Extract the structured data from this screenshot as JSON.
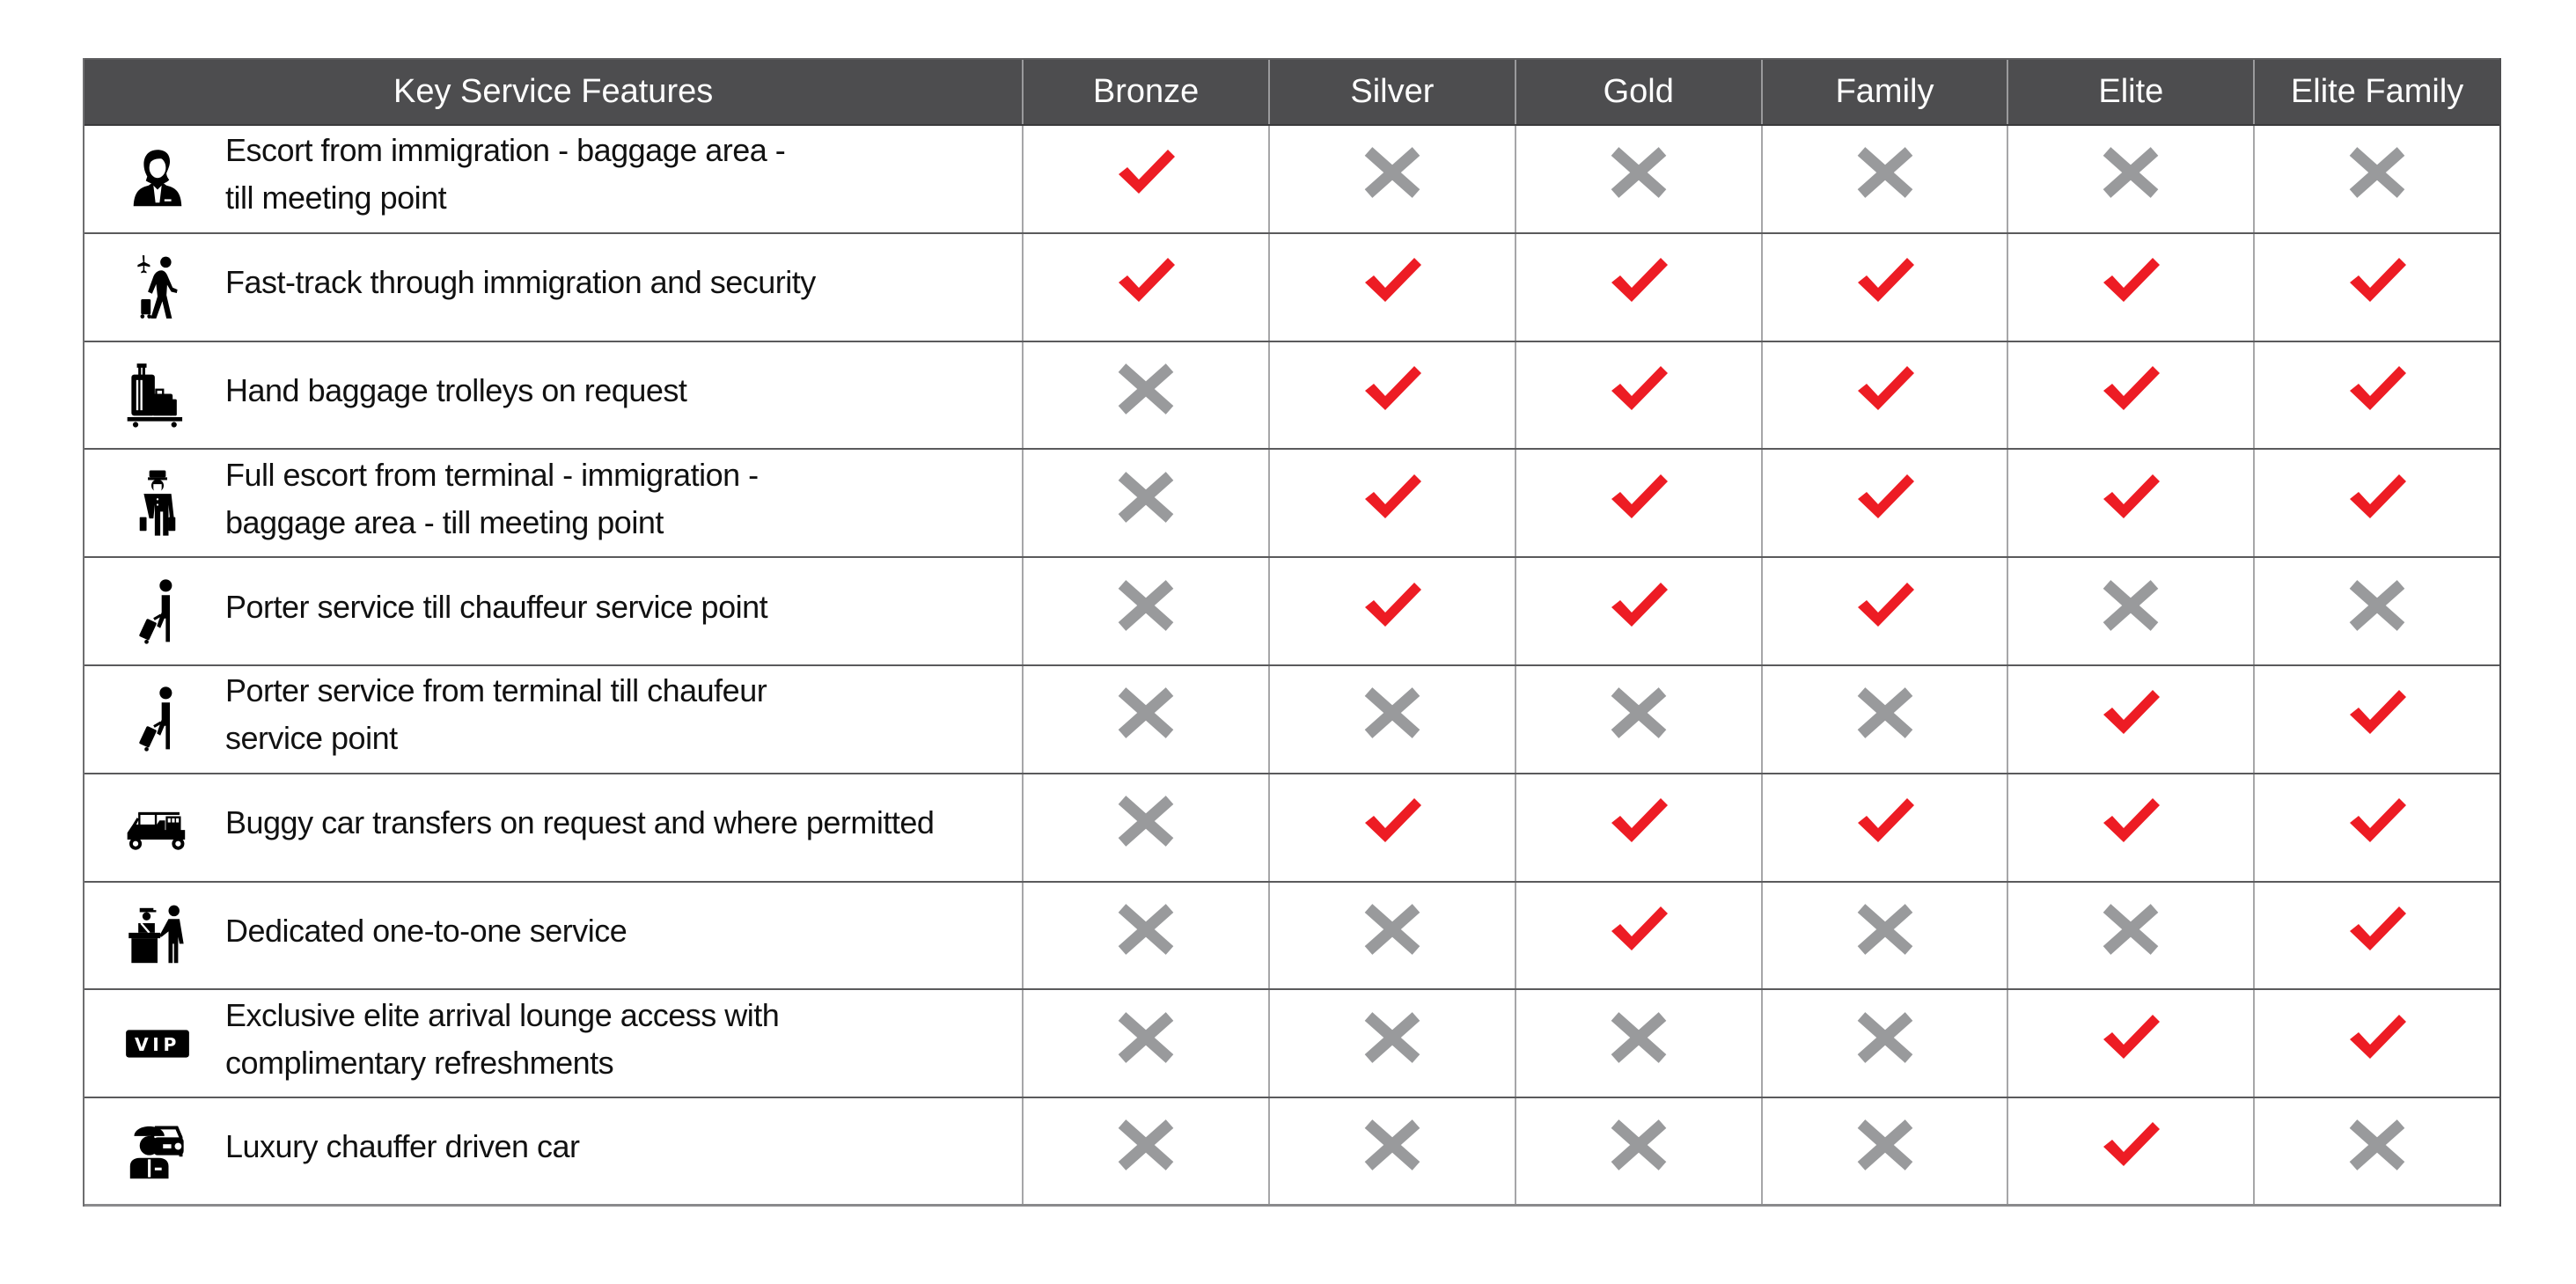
{
  "colors": {
    "header_bg": "#4d4d4f",
    "header_text": "#ffffff",
    "check": "#ed1c24",
    "cross": "#999a9c"
  },
  "header": {
    "feature_col": "Key Service Features",
    "tiers": [
      "Bronze",
      "Silver",
      "Gold",
      "Family",
      "Elite",
      "Elite Family"
    ]
  },
  "rows": [
    {
      "icon": "female-agent-icon",
      "feature": "Escort from immigration - baggage area -\ntill meeting point",
      "availability": [
        true,
        false,
        false,
        false,
        false,
        false
      ]
    },
    {
      "icon": "traveler-fast-track-icon",
      "feature": "Fast-track through immigration and security",
      "availability": [
        true,
        true,
        true,
        true,
        true,
        true
      ]
    },
    {
      "icon": "baggage-trolley-icon",
      "feature": "Hand baggage trolleys on request",
      "availability": [
        false,
        true,
        true,
        true,
        true,
        true
      ]
    },
    {
      "icon": "bellhop-escort-icon",
      "feature": "Full escort from terminal - immigration -\nbaggage area - till meeting point",
      "availability": [
        false,
        true,
        true,
        true,
        true,
        true
      ]
    },
    {
      "icon": "porter-icon",
      "feature": "Porter service till chauffeur service point",
      "availability": [
        false,
        true,
        true,
        true,
        false,
        false
      ]
    },
    {
      "icon": "porter-icon",
      "feature": "Porter service from terminal till chaufeur\nservice point",
      "availability": [
        false,
        false,
        false,
        false,
        true,
        true
      ]
    },
    {
      "icon": "buggy-car-icon",
      "feature": "Buggy car transfers on request and where permitted",
      "availability": [
        false,
        true,
        true,
        true,
        true,
        true
      ]
    },
    {
      "icon": "service-desk-icon",
      "feature": "Dedicated one-to-one service",
      "availability": [
        false,
        false,
        true,
        false,
        false,
        true
      ]
    },
    {
      "icon": "vip-badge-icon",
      "feature": "Exclusive elite arrival lounge access with\ncomplimentary refreshments",
      "availability": [
        false,
        false,
        false,
        false,
        true,
        true
      ]
    },
    {
      "icon": "chauffeur-car-icon",
      "feature": "Luxury chauffer driven car",
      "availability": [
        false,
        false,
        false,
        false,
        true,
        false
      ]
    }
  ],
  "icons": {
    "vip_text": "VIP"
  }
}
